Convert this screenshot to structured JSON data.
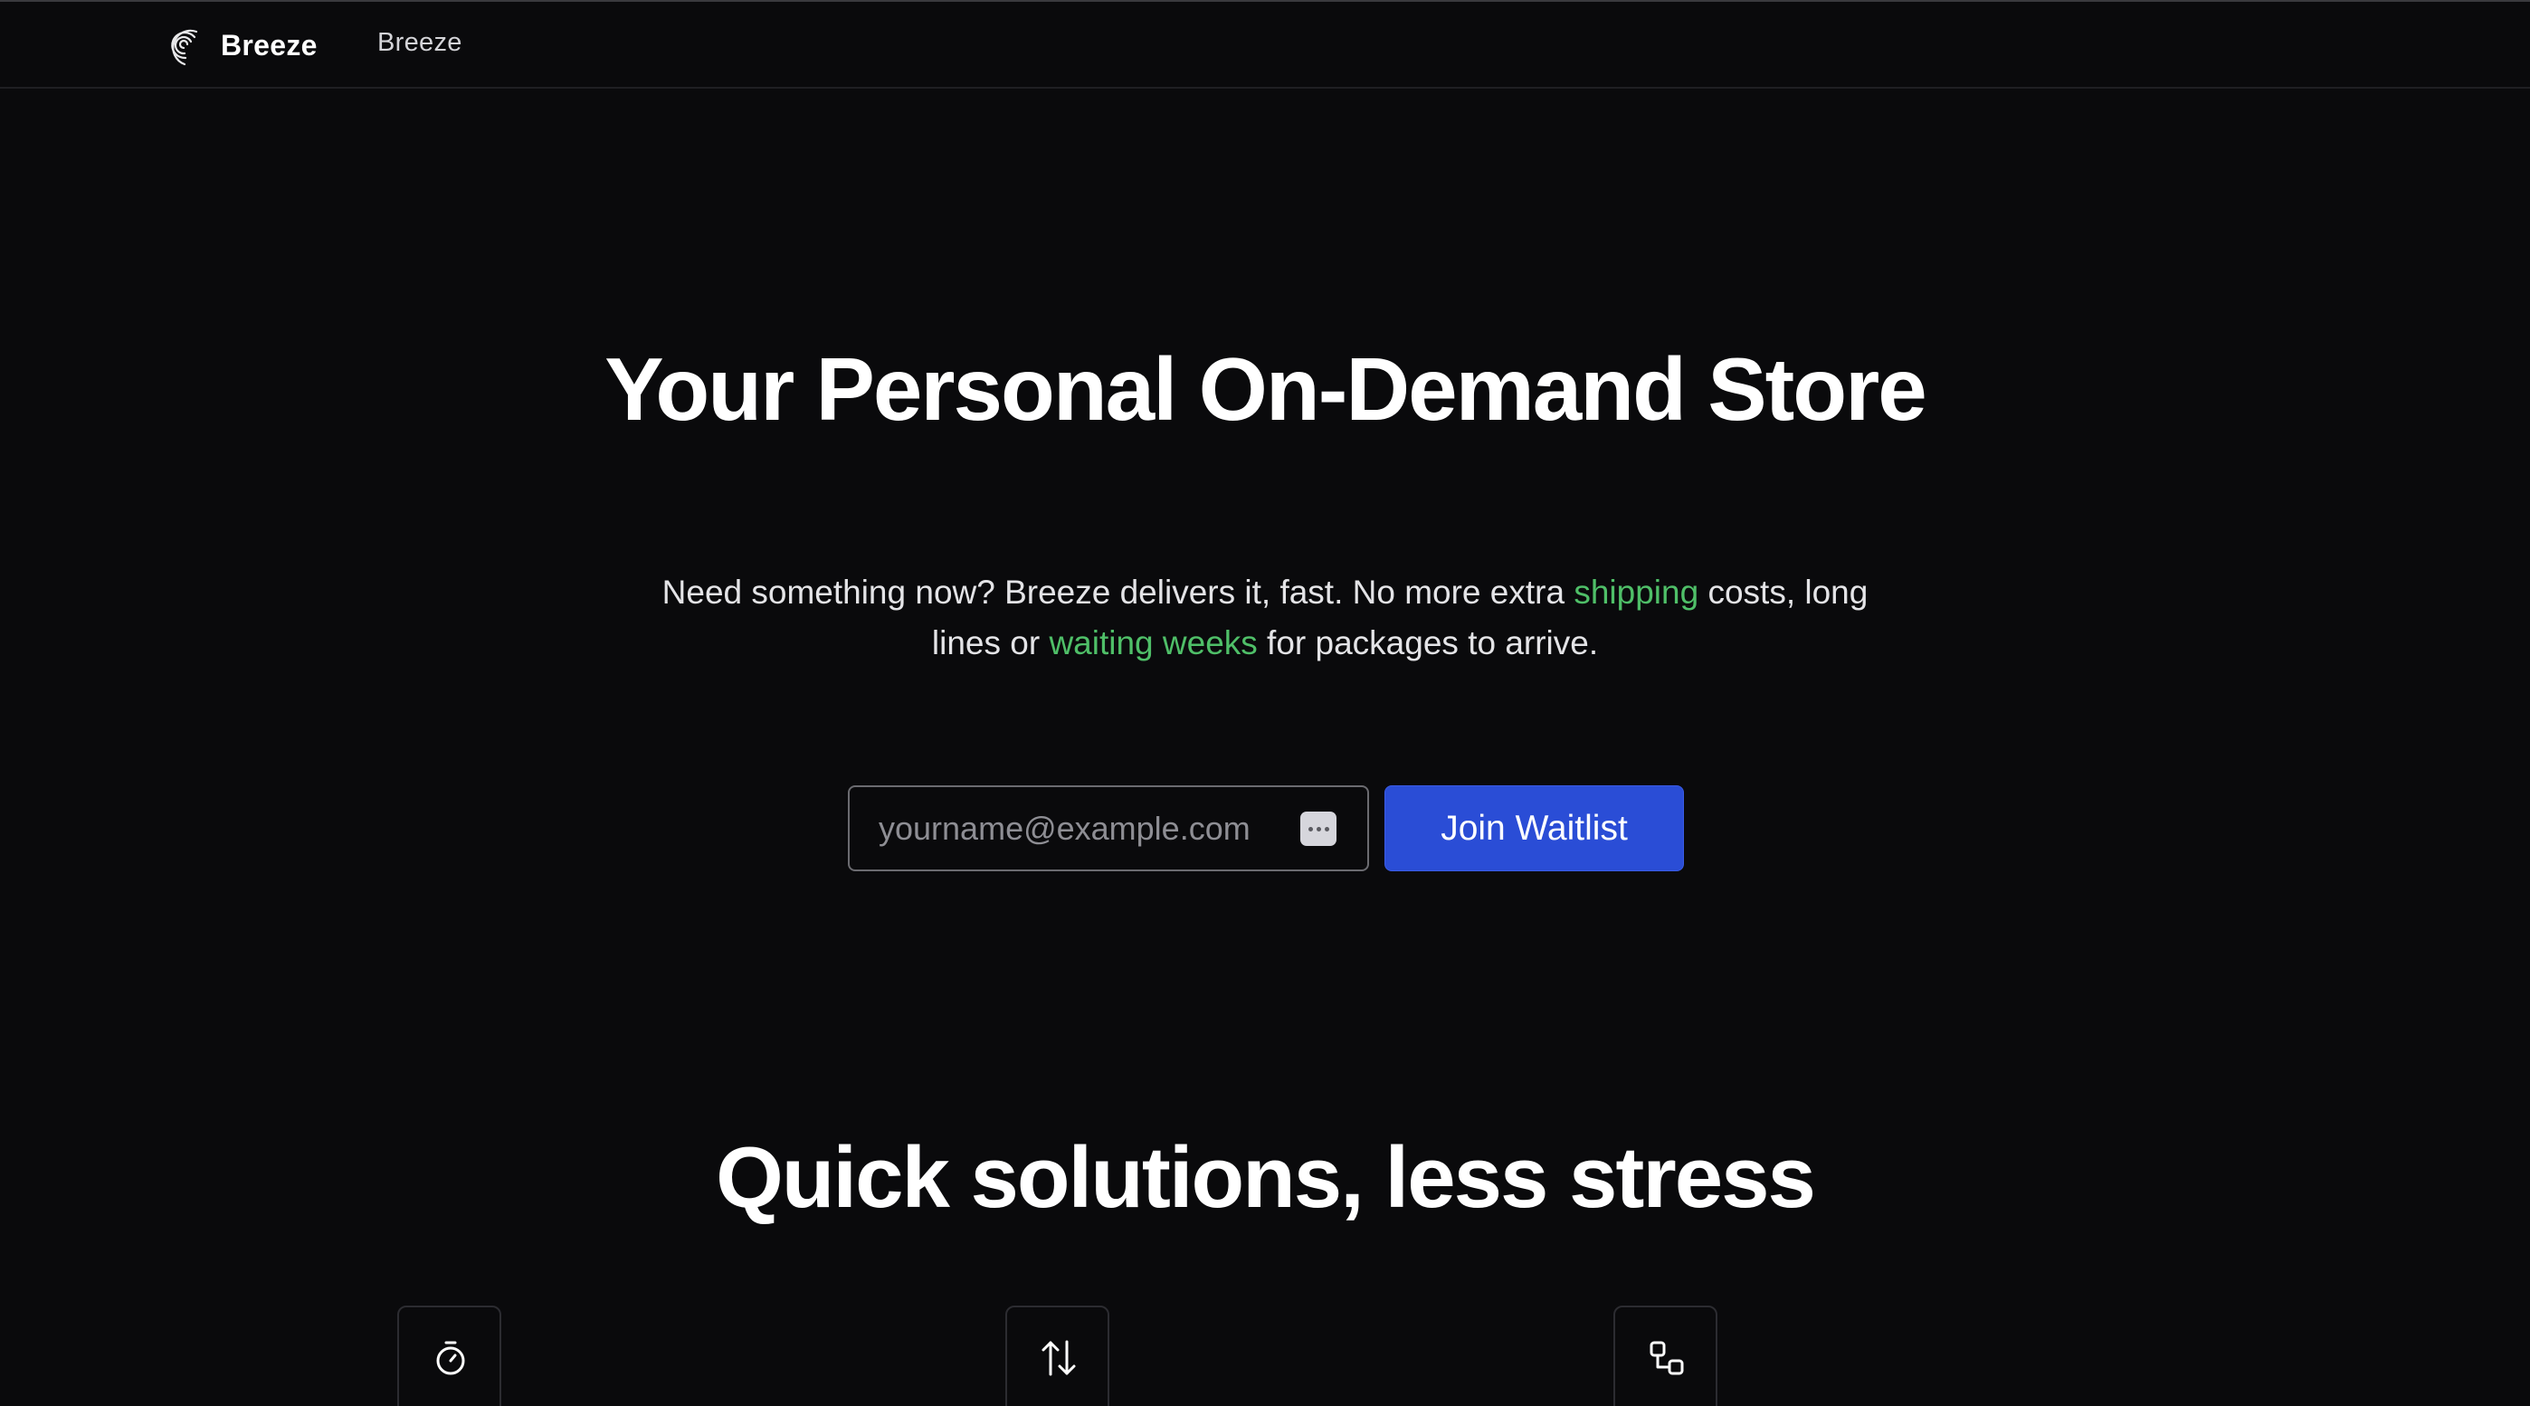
{
  "header": {
    "brand_name": "Breeze",
    "brand_icon": "breeze-swirl-logo",
    "nav_link": "Breeze"
  },
  "hero": {
    "title": "Your Personal On-Demand Store",
    "subtitle": {
      "part1": "Need something now? Breeze delivers it, fast. No more extra ",
      "highlight1": "shipping",
      "part2": " costs, long lines or ",
      "highlight2": "waiting weeks",
      "part3": " for packages to arrive."
    },
    "highlight_color": "#4fbf68"
  },
  "waitlist": {
    "email_placeholder": "yourname@example.com",
    "email_value": "",
    "autofill_icon": "password-autofill-icon",
    "button_label": "Join Waitlist",
    "button_color": "#2a4dd6"
  },
  "features": {
    "title": "Quick solutions, less stress",
    "icons": [
      "stopwatch-icon",
      "arrows-up-down-icon",
      "nodes-icon"
    ]
  },
  "colors": {
    "background": "#0a0a0c",
    "text": "#ffffff"
  }
}
